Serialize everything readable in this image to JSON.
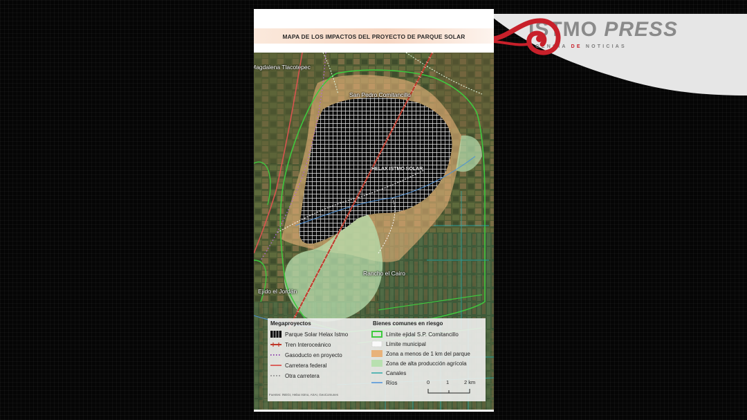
{
  "brand": {
    "name_part1": "ISTMO ",
    "name_part2": "PRESS",
    "tagline_part1": "AGENCIA ",
    "tagline_part2": "DE",
    "tagline_part3": " NOTICIAS",
    "colors": {
      "banner": "#e6e6e6",
      "text": "#8a8a8a",
      "accent": "#c8202a"
    }
  },
  "map": {
    "title": "MAPA DE LOS IMPACTOS DEL PROYECTO DE PARQUE SOLAR",
    "places": {
      "magdalena": "Magdalena Tlacotepec",
      "san_pedro": "San Pedro Comitancillo",
      "helax": "HELAX ISTMO SOLAR",
      "rancho": "Rancho el Cairo",
      "ejido": "Ejido el Jordán"
    },
    "legend": {
      "megaproyectos_heading": "Megaproyectos",
      "bienes_heading": "Bienes comunes en riesgo",
      "megaproyectos": [
        "Parque Solar Helax Istmo",
        "Tren Interoceánico",
        "Gasoducto en proyecto",
        "Carretera federal",
        "Otra carretera"
      ],
      "bienes": [
        "Límite ejidal S.P. Comitancillo",
        "Límite municipal",
        "Zona a menos de 1 km del parque",
        "Zona de alta producción agrícola",
        "Canales",
        "Ríos"
      ],
      "source": "Fuentes: INEGI, Helax Istmo, ASAI, GeoComunes"
    },
    "scale": {
      "labels": [
        "0",
        "1",
        "2 km"
      ]
    },
    "colors": {
      "solar_park": "#0d0d0d",
      "train": "#c0392b",
      "gas": "#8e44ad",
      "federal_road": "#d9534f",
      "other_road": "#ffffff",
      "ejido_limit": "#3ec93e",
      "municipal_limit": "#ffffff",
      "zone_1km": "#e8b27a",
      "agri_zone": "#b8e0b0",
      "canals": "#2aa7a7",
      "rivers": "#4a90d9"
    }
  }
}
